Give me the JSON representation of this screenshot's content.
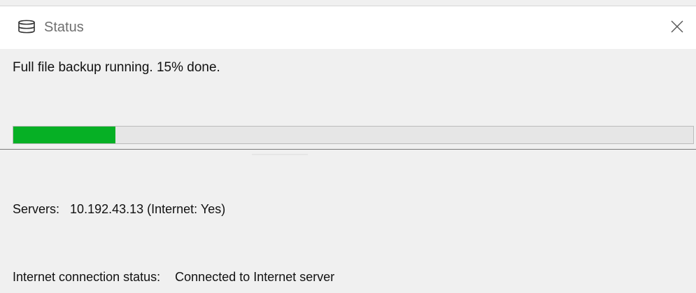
{
  "window": {
    "title": "Status",
    "title_icon": "database-icon",
    "close_icon": "close-icon"
  },
  "status": {
    "message": "Full file backup running. 15% done.",
    "progress_percent": 15,
    "progress_color": "#06b025"
  },
  "info": {
    "servers_label": "Servers:",
    "servers_value": "10.192.43.13 (Internet: Yes)",
    "internet_label": "Internet connection status:",
    "internet_value": "Connected to Internet server"
  }
}
